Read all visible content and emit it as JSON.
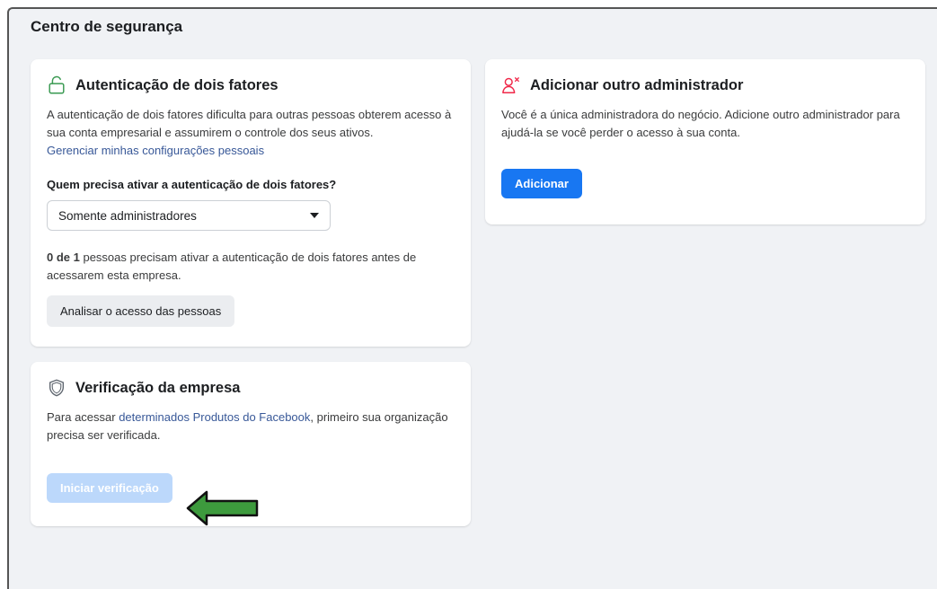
{
  "page": {
    "title": "Centro de segurança"
  },
  "two_factor": {
    "title": "Autenticação de dois fatores",
    "description": "A autenticação de dois fatores dificulta para outras pessoas obterem acesso à sua conta empresarial e assumirem o controle dos seus ativos.",
    "manage_link": "Gerenciar minhas configurações pessoais",
    "question": "Quem precisa ativar a autenticação de dois fatores?",
    "select_value": "Somente administradores",
    "count_bold": "0 de 1",
    "count_rest": " pessoas precisam ativar a autenticação de dois fatores antes de acessarem esta empresa.",
    "review_button": "Analisar o acesso das pessoas",
    "icon": "unlock-icon"
  },
  "add_admin": {
    "title": "Adicionar outro administrador",
    "description": "Você é a única administradora do negócio. Adicione outro administrador para ajudá-la se você perder o acesso à sua conta.",
    "button": "Adicionar",
    "icon": "add-person-icon"
  },
  "verification": {
    "title": "Verificação da empresa",
    "desc_before": "Para acessar ",
    "desc_link": "determinados Produtos do Facebook",
    "desc_after": ", primeiro sua organização precisa ser verificada.",
    "button": "Iniciar verificação",
    "icon": "shield-icon"
  },
  "colors": {
    "accent": "#1877f2",
    "link": "#385898",
    "disabled_button": "#bcd8fb",
    "annotation_arrow": "#3d9a3d",
    "danger_icon": "#f02849"
  }
}
